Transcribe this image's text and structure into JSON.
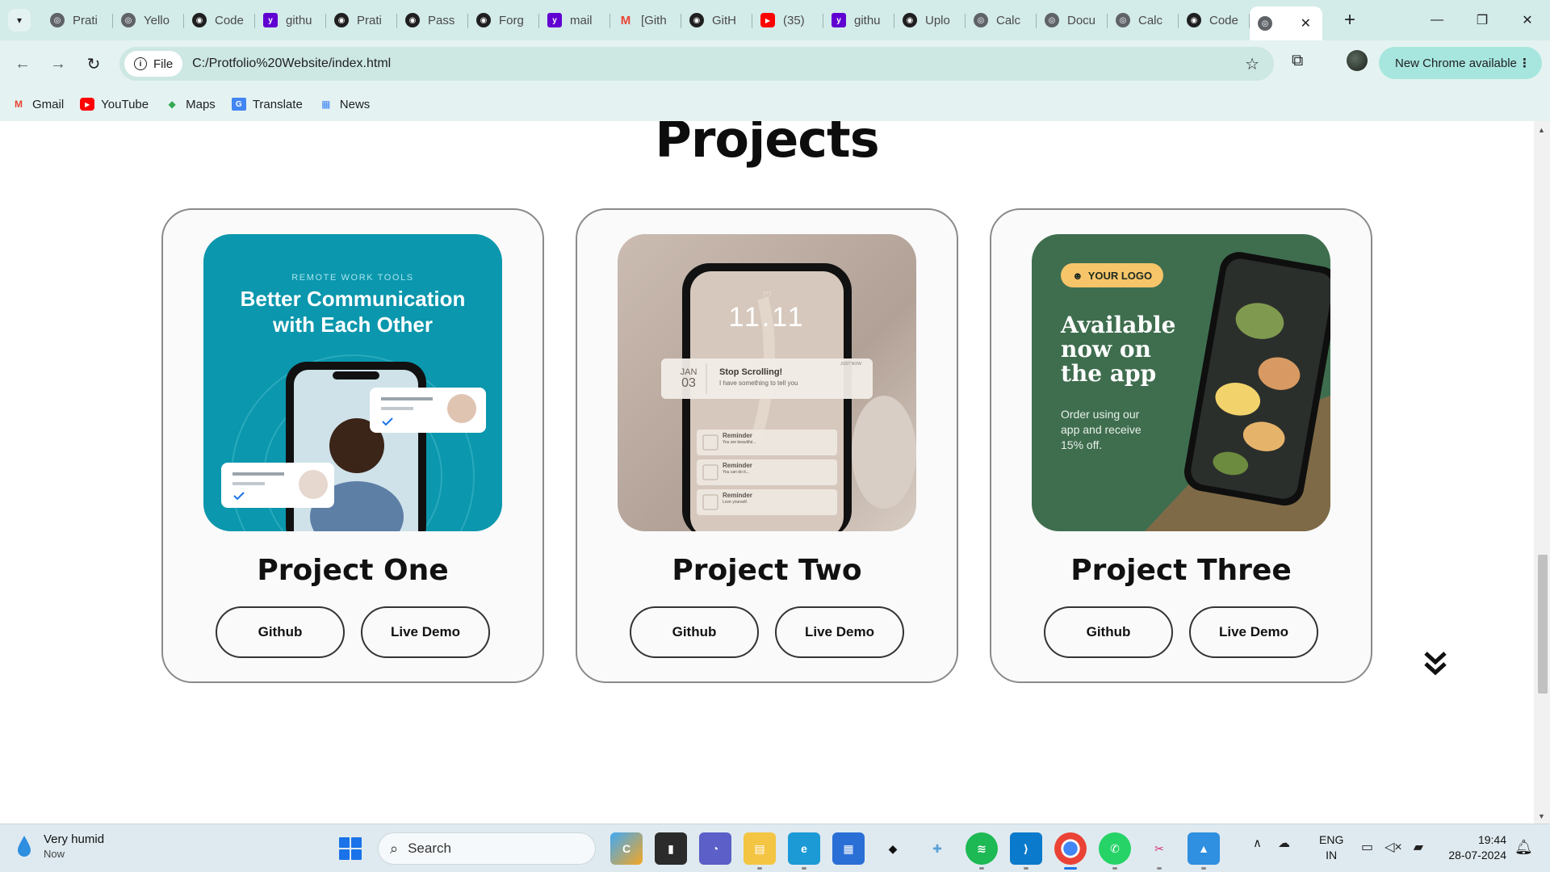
{
  "browser": {
    "tabs": [
      {
        "label": "Prati",
        "icon": "globe-icon",
        "color": "#5f6368"
      },
      {
        "label": "Yello",
        "icon": "globe-icon",
        "color": "#5f6368"
      },
      {
        "label": "Code",
        "icon": "github-icon",
        "color": "#1f1f1f"
      },
      {
        "label": "githu",
        "icon": "yahoo-icon",
        "color": "#6001d2"
      },
      {
        "label": "Prati",
        "icon": "github-icon",
        "color": "#1f1f1f"
      },
      {
        "label": "Pass",
        "icon": "github-icon",
        "color": "#1f1f1f"
      },
      {
        "label": "Forg",
        "icon": "github-icon",
        "color": "#1f1f1f"
      },
      {
        "label": "mail",
        "icon": "yahoo-icon",
        "color": "#6001d2"
      },
      {
        "label": "[Gith",
        "icon": "gmail-icon",
        "color": "#ea4335"
      },
      {
        "label": "GitH",
        "icon": "github-icon",
        "color": "#1f1f1f"
      },
      {
        "label": "(35)",
        "icon": "youtube-icon",
        "color": "#ff0000"
      },
      {
        "label": "githu",
        "icon": "yahoo-icon",
        "color": "#6001d2"
      },
      {
        "label": "Uplo",
        "icon": "github-icon",
        "color": "#1f1f1f"
      },
      {
        "label": "Calc",
        "icon": "globe-icon",
        "color": "#5f6368"
      },
      {
        "label": "Docu",
        "icon": "globe-icon",
        "color": "#5f6368"
      },
      {
        "label": "Calc",
        "icon": "globe-icon",
        "color": "#5f6368"
      },
      {
        "label": "Code",
        "icon": "github-icon",
        "color": "#1f1f1f"
      }
    ],
    "new_tab": "+",
    "close_tab": "✕",
    "site_chip": "File",
    "url": "C:/Protfolio%20Website/index.html",
    "update_chip": "New Chrome available",
    "bookmarks": [
      {
        "label": "Gmail",
        "icon": "gmail-icon",
        "color": "#ea4335"
      },
      {
        "label": "YouTube",
        "icon": "youtube-icon",
        "color": "#ff0000"
      },
      {
        "label": "Maps",
        "icon": "maps-icon",
        "color": "#34a853"
      },
      {
        "label": "Translate",
        "icon": "translate-icon",
        "color": "#4285f4"
      },
      {
        "label": "News",
        "icon": "news-icon",
        "color": "#4285f4"
      }
    ]
  },
  "page": {
    "section_title": "Projects",
    "projects": [
      {
        "title": "Project One",
        "github": "Github",
        "demo": "Live Demo",
        "thumb_kicker": "REMOTE WORK TOOLS",
        "thumb_headline_1": "Better Communication",
        "thumb_headline_2": "with Each Other"
      },
      {
        "title": "Project Two",
        "github": "Github",
        "demo": "Live Demo",
        "thumb_time": "11.11",
        "thumb_month": "JAN",
        "thumb_day": "03",
        "thumb_notice_title": "Stop Scrolling!",
        "thumb_notice_sub": "I have something to tell you",
        "thumb_notice_tag": "JUST NOW",
        "thumb_reminder": "Reminder",
        "thumb_reminder_1": "You are beautiful...",
        "thumb_reminder_2": "You can do it...",
        "thumb_reminder_3": "Love yourself."
      },
      {
        "title": "Project Three",
        "github": "Github",
        "demo": "Live Demo",
        "thumb_logo": "YOUR LOGO",
        "thumb_headline_1": "Available",
        "thumb_headline_2": "now on",
        "thumb_headline_3": "the app",
        "thumb_sub_1": "Order using our",
        "thumb_sub_2": "app and receive",
        "thumb_sub_3": "15% off."
      }
    ]
  },
  "taskbar": {
    "weather_title": "Very humid",
    "weather_sub": "Now",
    "search_label": "Search",
    "lang_1": "ENG",
    "lang_2": "IN",
    "time": "19:44",
    "date": "28-07-2024"
  }
}
